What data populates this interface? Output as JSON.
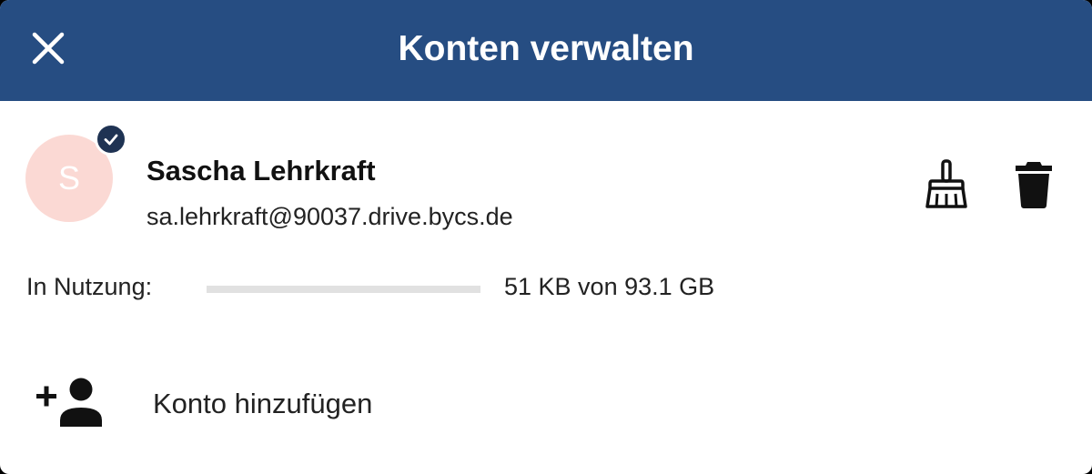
{
  "header": {
    "title": "Konten verwalten",
    "close_icon": "close-icon",
    "background_color": "#264d82"
  },
  "account": {
    "avatar_initial": "S",
    "avatar_color": "#fbd9d4",
    "name": "Sascha Lehrkraft",
    "email": "sa.lehrkraft@90037.drive.bycs.de",
    "active_icon": "check-circle-icon",
    "actions": [
      {
        "icon": "broom-icon"
      },
      {
        "icon": "trash-icon"
      }
    ]
  },
  "usage": {
    "label": "In Nutzung:",
    "value": "51 KB von 93.1 GB",
    "fraction_used": 0.0
  },
  "add_account": {
    "label": "Konto hinzufügen",
    "icon": "person-add-icon"
  }
}
